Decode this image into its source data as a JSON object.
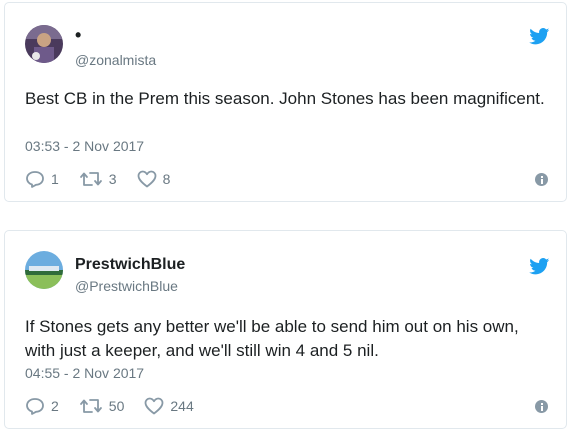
{
  "tweets": [
    {
      "display_name": "•",
      "handle": "@zonalmista",
      "text": "Best CB in the Prem this season. John Stones has been magnificent.",
      "timestamp": "03:53 - 2 Nov 2017",
      "replies": "1",
      "retweets": "3",
      "likes": "8",
      "avatar_colors": [
        "#6e5a8a",
        "#c9a383",
        "#3a2a4a"
      ]
    },
    {
      "display_name": "PrestwichBlue",
      "handle": "@PrestwichBlue",
      "text": "If Stones gets any better we'll be able to send him out on his own, with just a keeper, and we'll still win 4 and 5 nil.",
      "timestamp": "04:55 - 2 Nov 2017",
      "replies": "2",
      "retweets": "50",
      "likes": "244",
      "avatar_colors": [
        "#6caddf",
        "#2f6b3a",
        "#8bbf5a"
      ]
    }
  ],
  "icons": {
    "brand": "twitter-bird-icon",
    "reply": "reply-icon",
    "retweet": "retweet-icon",
    "like": "heart-icon",
    "info": "info-icon"
  },
  "colors": {
    "twitter_blue": "#1da1f2",
    "muted_text": "#697882",
    "action_icon": "#8899a6",
    "border": "#e1e8ed"
  }
}
